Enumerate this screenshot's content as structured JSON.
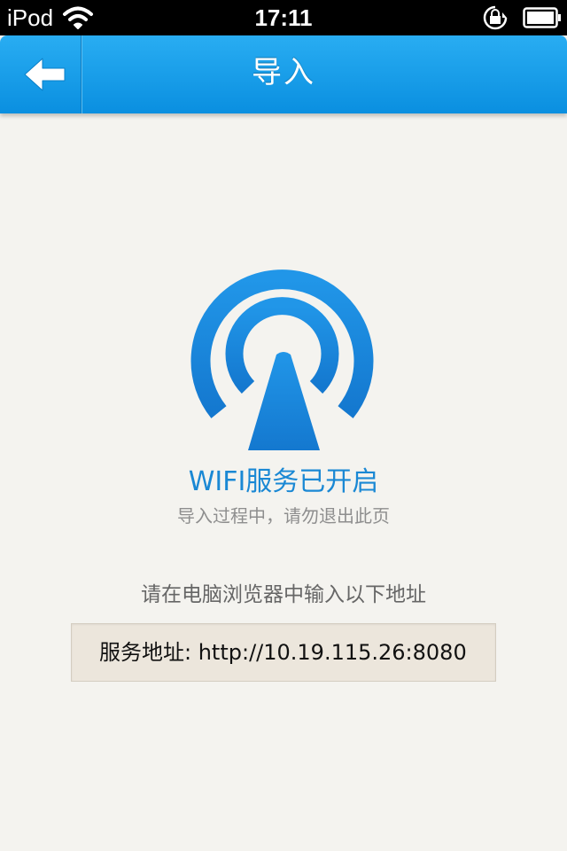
{
  "status_bar": {
    "carrier": "iPod",
    "time": "17:11",
    "icons": [
      "wifi-icon",
      "orientation-lock-icon",
      "battery-icon"
    ]
  },
  "nav": {
    "title": "导入",
    "back_icon": "back-arrow-icon"
  },
  "content": {
    "logo_icon": "wifi-broadcast-icon",
    "status_text": "WIFI服务已开启",
    "hint_text": "导入过程中，请勿退出此页",
    "instruction_text": "请在电脑浏览器中输入以下地址",
    "address_text": "服务地址: http://10.19.115.26:8080"
  },
  "colors": {
    "nav_top": "#29adf2",
    "nav_bottom": "#0a8fe0",
    "logo_blue": "#1a88d4",
    "background": "#f4f3ef",
    "address_box": "#ece6dc"
  }
}
